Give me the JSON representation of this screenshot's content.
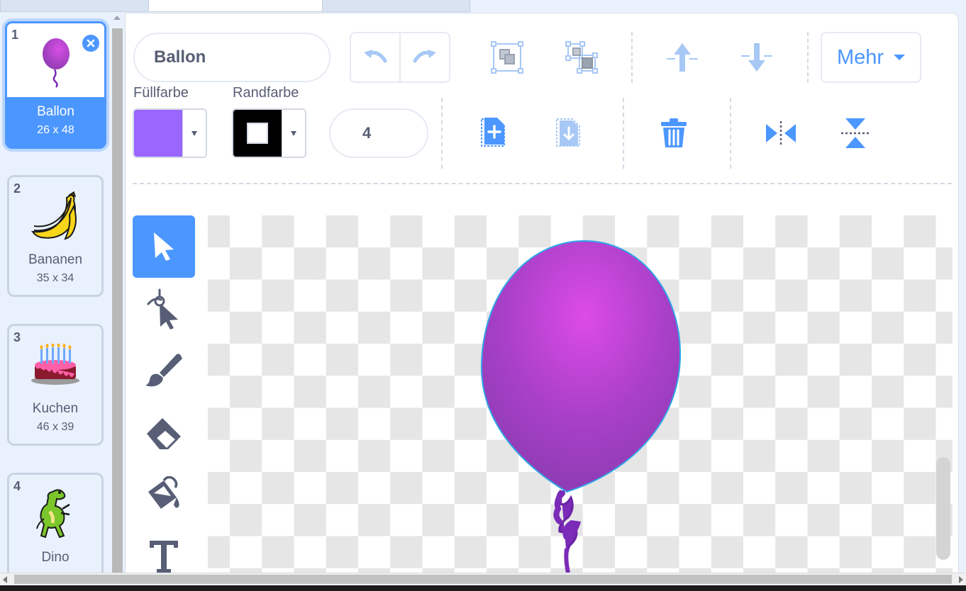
{
  "costumes": [
    {
      "number": "1",
      "name": "Ballon",
      "size": "26 x 48",
      "selected": true,
      "icon": "balloon-icon"
    },
    {
      "number": "2",
      "name": "Bananen",
      "size": "35 x 34",
      "selected": false,
      "icon": "bananas-icon"
    },
    {
      "number": "3",
      "name": "Kuchen",
      "size": "46 x 39",
      "selected": false,
      "icon": "cake-icon"
    },
    {
      "number": "4",
      "name": "Dino",
      "size": "",
      "selected": false,
      "icon": "dino-icon"
    }
  ],
  "editor": {
    "costume_name": "Ballon",
    "fill_label": "Füllfarbe",
    "outline_label": "Randfarbe",
    "outline_width": "4",
    "more_label": "Mehr",
    "fill_color": "#9966ff",
    "outline_color": "#000000"
  },
  "toolbar_icons": [
    "undo-icon",
    "redo-icon",
    "group-icon",
    "ungroup-icon",
    "forward-icon",
    "backward-icon",
    "copy-icon",
    "paste-icon",
    "delete-icon",
    "flip-horizontal-icon",
    "flip-vertical-icon"
  ],
  "tools": [
    "select-tool",
    "reshape-tool",
    "brush-tool",
    "eraser-tool",
    "fill-tool",
    "text-tool"
  ],
  "colors": {
    "accent": "#4c97ff",
    "text": "#575e75",
    "balloon": "#b342d6"
  }
}
